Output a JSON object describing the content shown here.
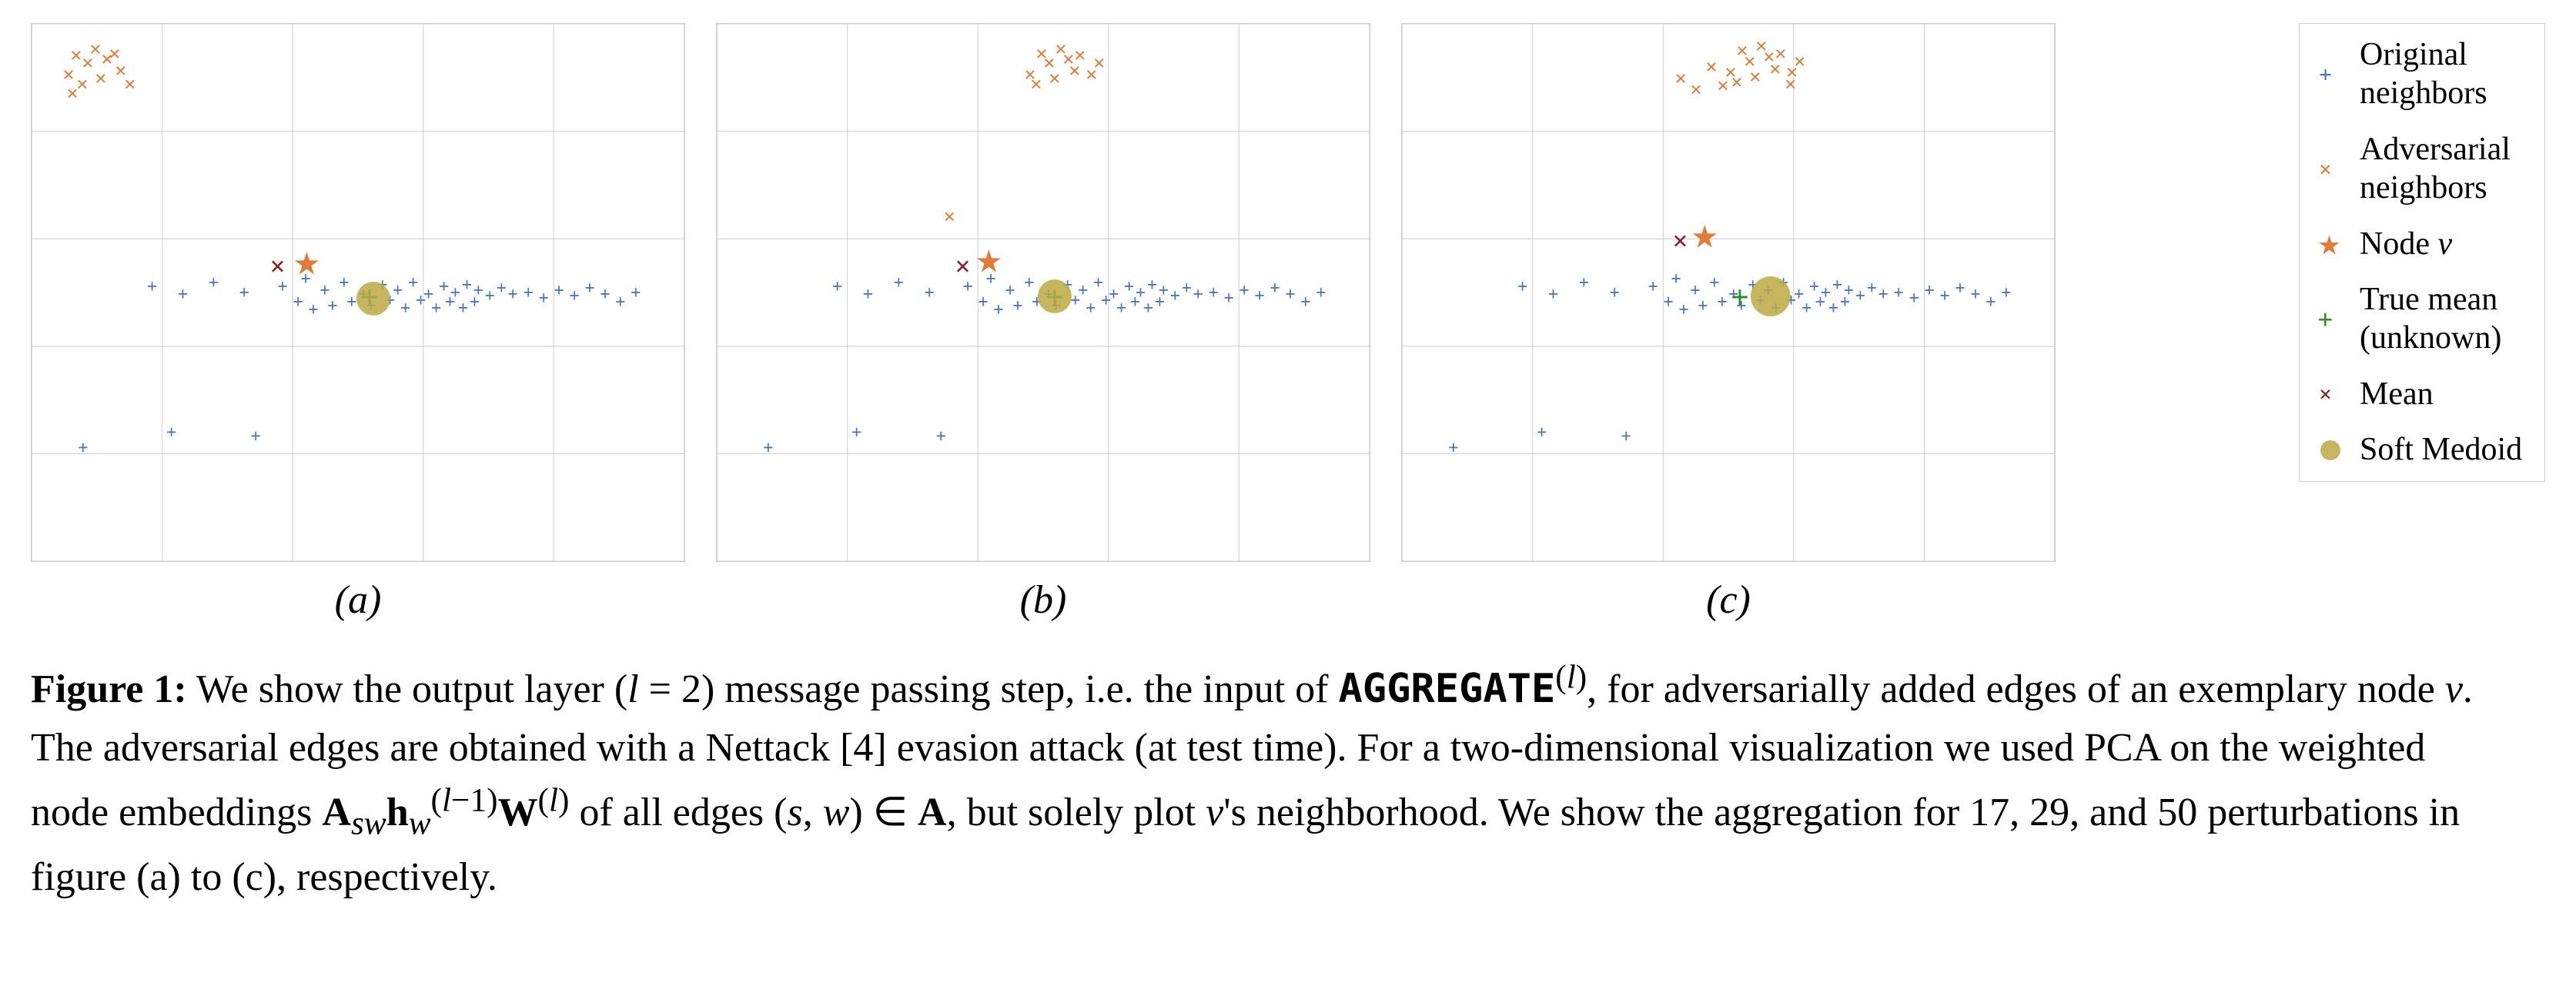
{
  "plots": [
    {
      "id": "a",
      "label": "(a)"
    },
    {
      "id": "b",
      "label": "(b)"
    },
    {
      "id": "c",
      "label": "(c)"
    }
  ],
  "legend": {
    "items": [
      {
        "symbol": "+",
        "color": "#4472C4",
        "label": "Original neighbors"
      },
      {
        "symbol": "×",
        "color": "#E07B39",
        "label": "Adversarial neighbors"
      },
      {
        "symbol": "★",
        "color": "#E07B39",
        "label": "Node v"
      },
      {
        "symbol": "+",
        "color": "#4CAF50",
        "label": "True mean (unknown)"
      },
      {
        "symbol": "×",
        "color": "#8B1C1C",
        "label": "Mean"
      },
      {
        "symbol": "●",
        "color": "#BDA944",
        "label": "Soft Medoid"
      }
    ]
  },
  "caption": {
    "text": "Figure 1: We show the output layer (l = 2) message passing step, i.e. the input of AGGREGATE",
    "superscript": "(l)",
    "rest": ", for adversarially added edges of an exemplary node v. The adversarial edges are obtained with a Nettack [4] evasion attack (at test time). For a two-dimensional visualization we used PCA on the weighted node embeddings A",
    "sub1": "sw",
    "math1": "h",
    "sup2": "(l−1)",
    "sub2": "w",
    "math2": "W",
    "sup3": "(l)",
    "rest2": " of all edges (s, w) ∈ A, but solely plot v's neighborhood. We show the aggregation for 17, 29, and 50 perturbations in figure (a) to (c), respectively."
  }
}
